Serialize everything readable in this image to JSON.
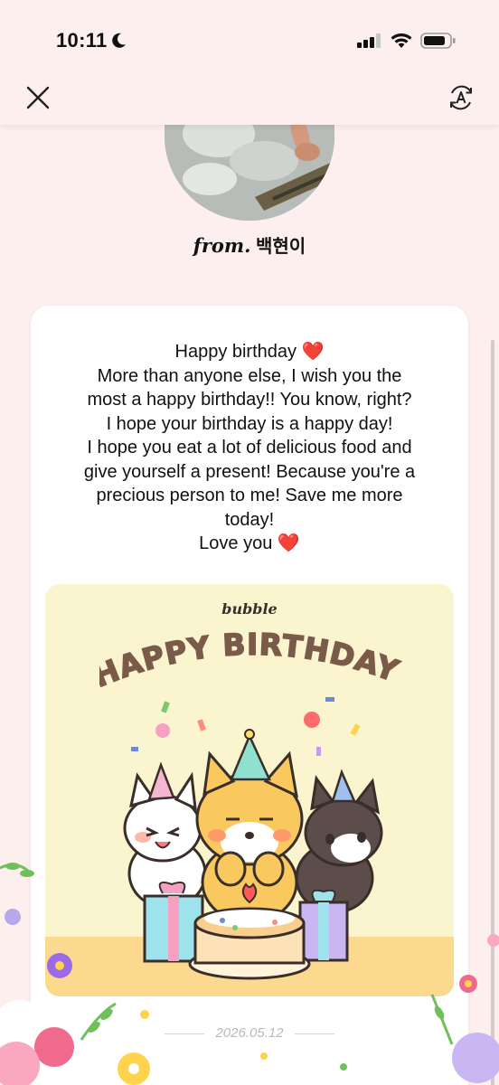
{
  "status_bar": {
    "time": "10:11"
  },
  "top_bar": {
    "close_icon": "close-icon",
    "translate_icon": "auto-translate-icon"
  },
  "sender": {
    "from_label": "from.",
    "name": "백현이"
  },
  "message": {
    "lines": [
      "Happy birthday ❤️",
      "More than anyone else, I wish you the",
      "most a happy birthday!! You know, right?",
      "I hope your birthday is a happy day!",
      "I hope you eat a lot of delicious food and",
      "give yourself a present! Because you're a",
      "precious person to me! Save me more",
      "today!",
      "Love you ❤️"
    ]
  },
  "birthday_card": {
    "brand": "bubble",
    "title": "HAPPY BIRTHDAY!"
  },
  "footer": {
    "date": "2026.05.12"
  },
  "colors": {
    "background": "#fcefee",
    "card": "#ffffff",
    "birthday_card_bg": "#faf4cf",
    "title_brown": "#7a5a48"
  }
}
